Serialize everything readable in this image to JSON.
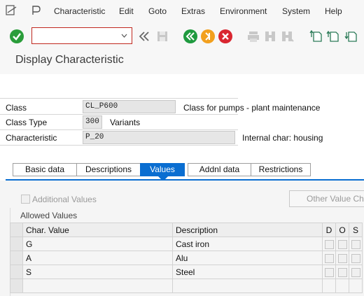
{
  "menu": {
    "items": [
      "Characteristic",
      "Edit",
      "Goto",
      "Extras",
      "Environment",
      "System",
      "Help"
    ]
  },
  "toolbar": {
    "command_value": "",
    "icons": [
      "enter-icon",
      "save-icon",
      "back-icon",
      "exit-icon",
      "cancel-icon",
      "print-icon",
      "find-icon",
      "find-next-icon",
      "first-page-icon",
      "previous-page-icon",
      "next-page-icon"
    ]
  },
  "page": {
    "title": "Display Characteristic"
  },
  "header": {
    "class_label": "Class",
    "class_value": "CL_P600",
    "class_desc": "Class for pumps - plant maintenance",
    "class_type_label": "Class Type",
    "class_type_value": "300",
    "class_type_desc": "Variants",
    "char_label": "Characteristic",
    "char_value": "P_20",
    "char_desc": "Internal char: housing"
  },
  "tabs": [
    {
      "label": "Basic data",
      "active": false
    },
    {
      "label": "Descriptions",
      "active": false
    },
    {
      "label": "Values",
      "active": true
    },
    {
      "label": "Addnl data",
      "active": false
    },
    {
      "label": "Restrictions",
      "active": false
    }
  ],
  "values_tab": {
    "additional_values_label": "Additional Values",
    "additional_values_checked": false,
    "other_value_button": "Other Value Ch",
    "allowed_values_title": "Allowed Values",
    "columns": [
      "Char. Value",
      "Description",
      "D",
      "O",
      "S"
    ],
    "rows": [
      {
        "value": "G",
        "description": "Cast iron"
      },
      {
        "value": "A",
        "description": "Alu"
      },
      {
        "value": "S",
        "description": "Steel"
      },
      {
        "value": "",
        "description": ""
      }
    ]
  },
  "colors": {
    "accent": "#0a6ed1",
    "enter_green": "#2a9d3a",
    "back_green": "#1f9a3f",
    "exit_orange": "#f2a01e",
    "cancel_red": "#d92630"
  }
}
